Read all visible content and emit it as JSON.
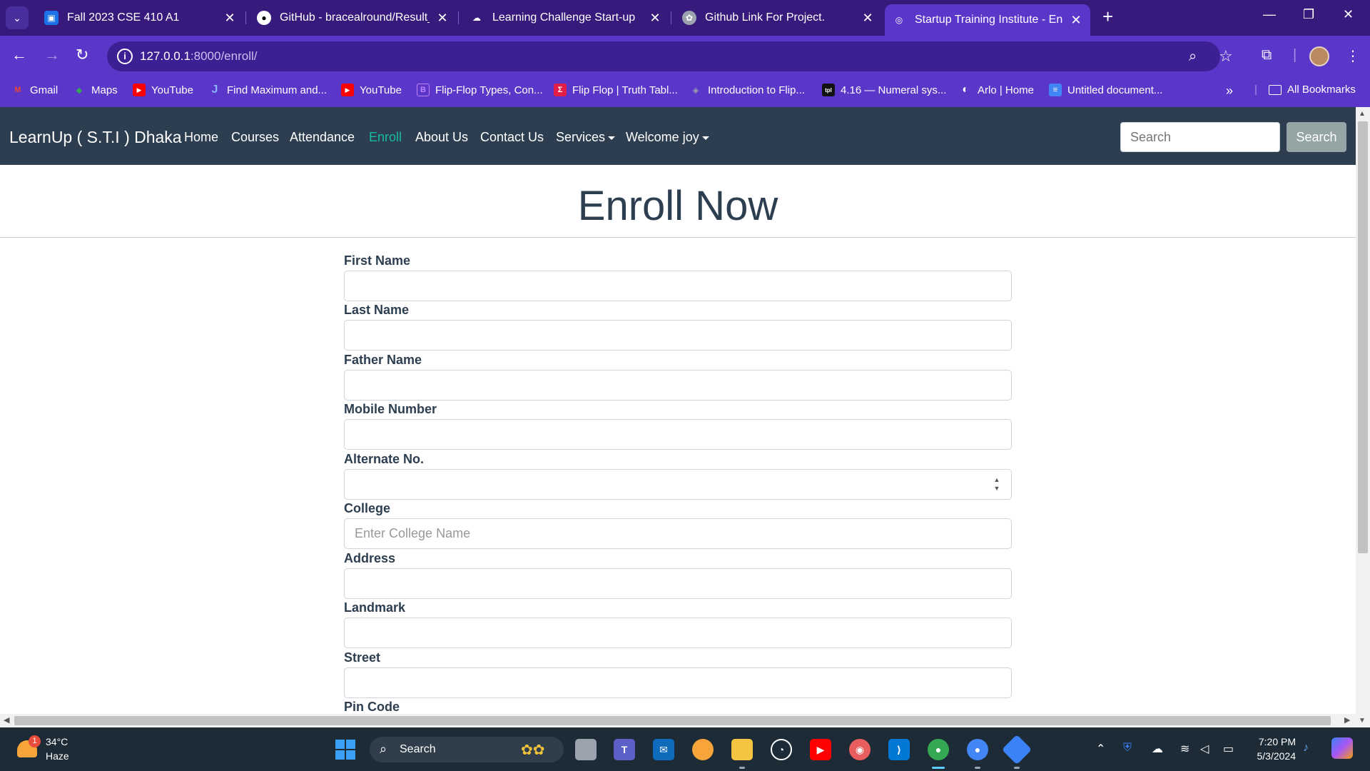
{
  "browser": {
    "tabs": [
      {
        "title": "Fall 2023 CSE 410 A1",
        "icon": "classroom-icon",
        "color": "#1a73e8"
      },
      {
        "title": "GitHub - bracealround/Result_P",
        "icon": "github-icon",
        "color": "#ffffff"
      },
      {
        "title": "Learning Challenge Start-up",
        "icon": "gdrive-icon",
        "color": "#ffffff"
      },
      {
        "title": "Github Link For Project.",
        "icon": "chatgpt-icon",
        "color": "#ffffff"
      },
      {
        "title": "Startup Training Institute - Enro",
        "icon": "globe-icon",
        "color": "#ffffff",
        "active": true
      }
    ],
    "url_host": "127.0.0.1",
    "url_path": ":8000/enroll/",
    "bookmarks": [
      {
        "label": "Gmail",
        "icon": "gmail-icon",
        "color": "#ea4335",
        "glyph": "M"
      },
      {
        "label": "Maps",
        "icon": "maps-icon",
        "color": "#34a853",
        "glyph": "◆"
      },
      {
        "label": "YouTube",
        "icon": "youtube-icon",
        "color": "#ff0000",
        "glyph": "▶"
      },
      {
        "label": "Find Maximum and...",
        "icon": "j-icon",
        "color": "#5a36c9",
        "glyph": "J"
      },
      {
        "label": "YouTube",
        "icon": "youtube-icon",
        "color": "#ff0000",
        "glyph": "▶"
      },
      {
        "label": "Flip-Flop Types, Con...",
        "icon": "bookmark-icon",
        "color": "#a855f7",
        "glyph": "B"
      },
      {
        "label": "Flip Flop | Truth Tabl...",
        "icon": "sigma-icon",
        "color": "#e11d48",
        "glyph": "Σ"
      },
      {
        "label": "Introduction to Flip...",
        "icon": "shield-icon",
        "color": "#374151",
        "glyph": "◈"
      },
      {
        "label": "4.16 — Numeral sys...",
        "icon": "tpl-icon",
        "color": "#1f2937",
        "glyph": "tpl"
      },
      {
        "label": "Arlo | Home",
        "icon": "arlo-icon",
        "color": "#ffffff",
        "glyph": "◐"
      },
      {
        "label": "Untitled document...",
        "icon": "docs-icon",
        "color": "#4285f4",
        "glyph": "≡"
      }
    ],
    "all_bookmarks": "All Bookmarks"
  },
  "site": {
    "brand": "LearnUp ( S.T.I ) Dhaka",
    "nav": [
      "Home",
      "Courses",
      "Attendance",
      "Enroll",
      "About Us",
      "Contact Us",
      "Services",
      "Welcome joy"
    ],
    "active_nav": "Enroll",
    "search_placeholder": "Search",
    "search_button": "Search",
    "accent": "#18bc9c",
    "navbar_bg": "#2c3e50"
  },
  "form": {
    "heading": "Enroll Now",
    "fields": [
      {
        "label": "First Name",
        "value": "",
        "placeholder": ""
      },
      {
        "label": "Last Name",
        "value": "",
        "placeholder": ""
      },
      {
        "label": "Father Name",
        "value": "",
        "placeholder": ""
      },
      {
        "label": "Mobile Number",
        "value": "",
        "placeholder": ""
      },
      {
        "label": "Alternate No.",
        "value": "",
        "placeholder": "",
        "type": "number"
      },
      {
        "label": "College",
        "value": "",
        "placeholder": "Enter College Name"
      },
      {
        "label": "Address",
        "value": "",
        "placeholder": ""
      },
      {
        "label": "Landmark",
        "value": "",
        "placeholder": ""
      },
      {
        "label": "Street",
        "value": "",
        "placeholder": ""
      },
      {
        "label": "Pin Code",
        "value": "",
        "placeholder": ""
      }
    ]
  },
  "taskbar": {
    "weather_temp": "34°C",
    "weather_cond": "Haze",
    "weather_badge": "1",
    "search_label": "Search",
    "time": "7:20 PM",
    "date": "5/3/2024"
  }
}
